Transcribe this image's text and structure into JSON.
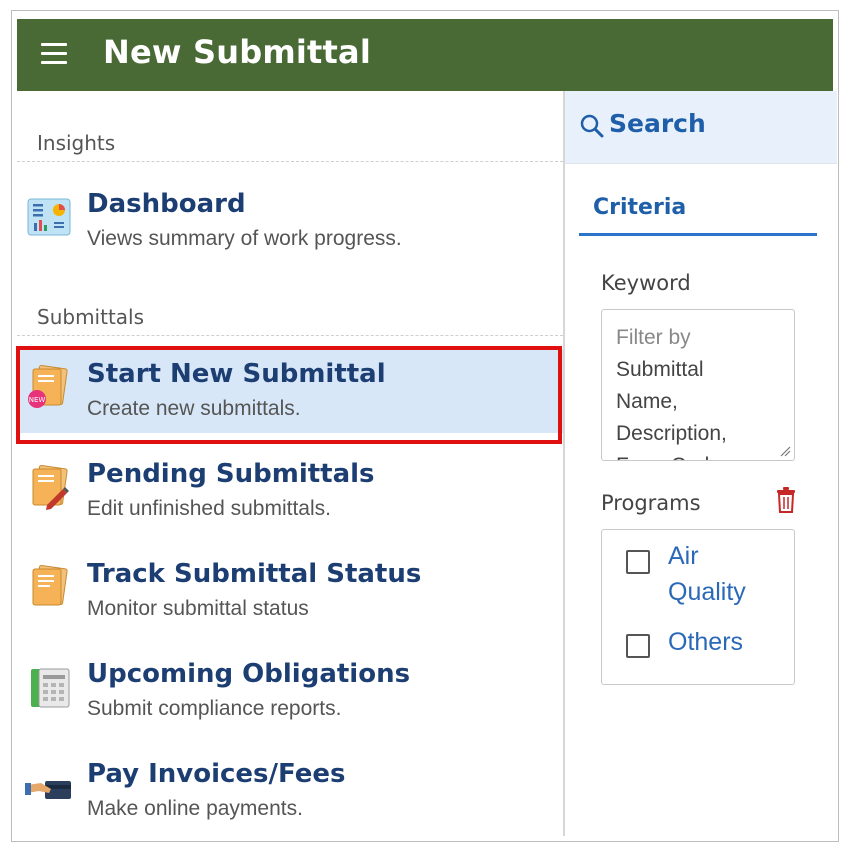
{
  "header": {
    "title": "New Submittal",
    "menu_icon": "hamburger-menu-icon",
    "background": "#4a6a35"
  },
  "sections": [
    {
      "label": "Insights"
    },
    {
      "label": "Submittals"
    }
  ],
  "items": [
    {
      "name": "Dashboard",
      "desc": "Views summary of work progress.",
      "icon": "dashboard-icon"
    },
    {
      "name": "Start New Submittal",
      "desc": "Create new submittals.",
      "icon": "new-document-icon",
      "selected": true
    },
    {
      "name": "Pending Submittals",
      "desc": "Edit unfinished submittals.",
      "icon": "edit-document-icon"
    },
    {
      "name": "Track Submittal Status",
      "desc": "Monitor submittal status",
      "icon": "document-status-icon"
    },
    {
      "name": "Upcoming Obligations",
      "desc": "Submit compliance reports.",
      "icon": "calendar-icon"
    },
    {
      "name": "Pay Invoices/Fees",
      "desc": "Make online payments.",
      "icon": "payment-card-icon"
    }
  ],
  "search": {
    "label": "Search",
    "tab": "Criteria",
    "keyword_label": "Keyword",
    "keyword_placeholder_lines": [
      "Filter by",
      "Submittal",
      "Name,",
      "Description,",
      "Form Code"
    ],
    "programs_label": "Programs",
    "programs": [
      {
        "label_lines": [
          "Air",
          "Quality"
        ],
        "checked": false
      },
      {
        "label_lines": [
          "Others"
        ],
        "checked": false
      }
    ]
  },
  "colors": {
    "accent": "#1f5ea8",
    "selection": "#d7e7f7",
    "highlight_border": "#e01010",
    "trash": "#c62828"
  }
}
